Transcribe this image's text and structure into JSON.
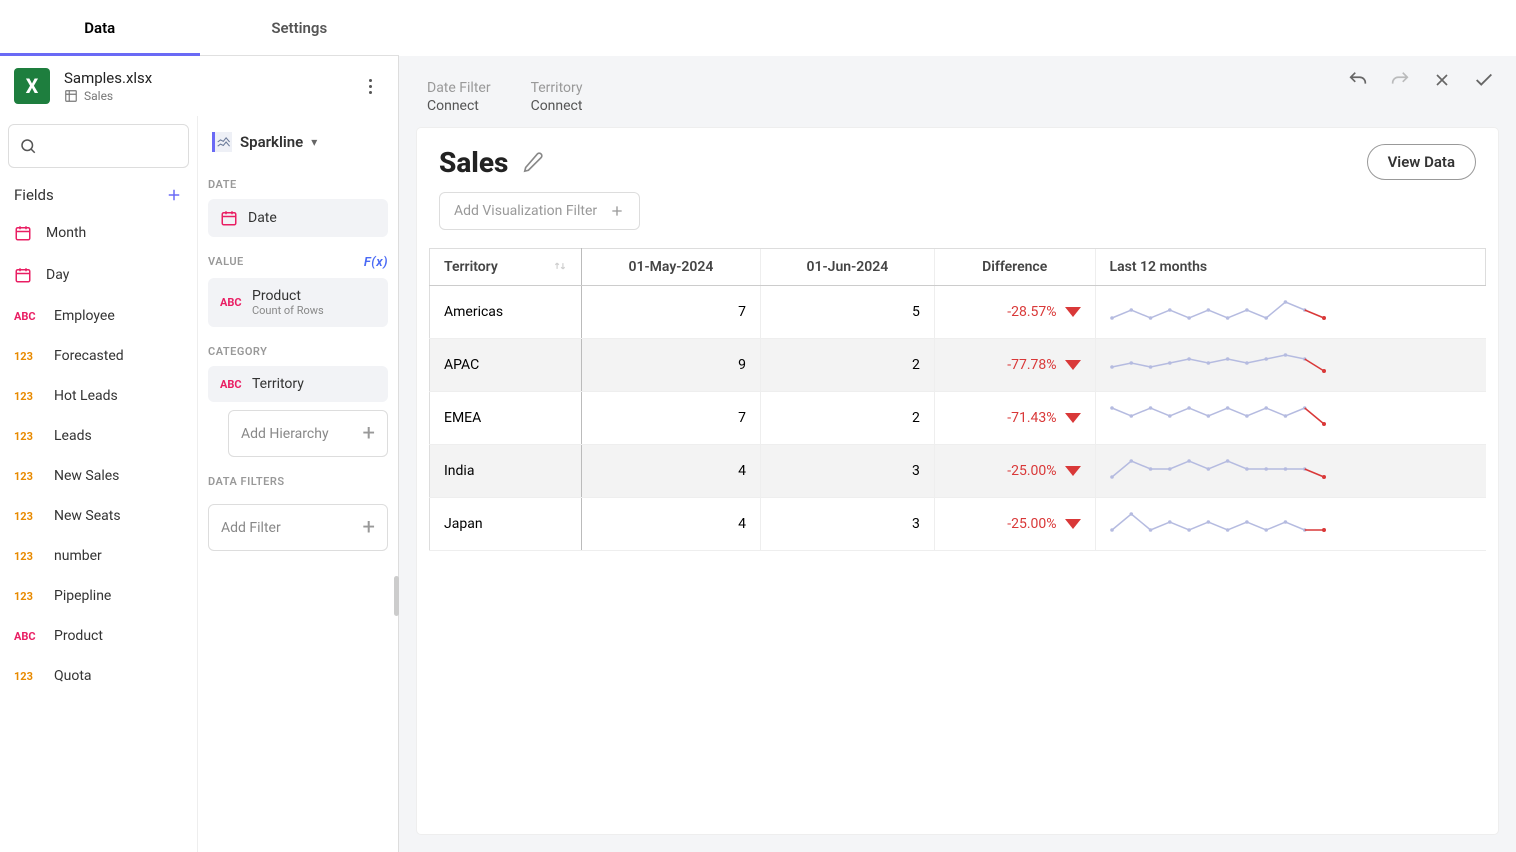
{
  "tabs": {
    "data": "Data",
    "settings": "Settings"
  },
  "dataSource": {
    "file": "Samples.xlsx",
    "sheet": "Sales"
  },
  "search": {
    "placeholder": ""
  },
  "fieldsHeader": "Fields",
  "fields": [
    {
      "type": "date",
      "label": "Month"
    },
    {
      "type": "date",
      "label": "Day"
    },
    {
      "type": "abc",
      "label": "Employee"
    },
    {
      "type": "num",
      "label": "Forecasted"
    },
    {
      "type": "num",
      "label": "Hot Leads"
    },
    {
      "type": "num",
      "label": "Leads"
    },
    {
      "type": "num",
      "label": "New Sales"
    },
    {
      "type": "num",
      "label": "New Seats"
    },
    {
      "type": "num",
      "label": "number"
    },
    {
      "type": "num",
      "label": "Pipepline"
    },
    {
      "type": "abc",
      "label": "Product"
    },
    {
      "type": "num",
      "label": "Quota"
    }
  ],
  "config": {
    "vizLabel": "Sparkline",
    "dateHeading": "DATE",
    "dateField": "Date",
    "valueHeading": "VALUE",
    "fxLabel": "F(x)",
    "valueField": "Product",
    "valueAgg": "Count of Rows",
    "categoryHeading": "CATEGORY",
    "categoryField": "Territory",
    "addHierarchy": "Add Hierarchy",
    "dataFiltersHeading": "DATA FILTERS",
    "addFilter": "Add Filter"
  },
  "topFilters": [
    {
      "label": "Date Filter",
      "value": "Connect"
    },
    {
      "label": "Territory",
      "value": "Connect"
    }
  ],
  "canvas": {
    "title": "Sales",
    "viewData": "View Data",
    "addVizFilter": "Add Visualization Filter",
    "columns": [
      "Territory",
      "01-May-2024",
      "01-Jun-2024",
      "Difference",
      "Last 12 months"
    ]
  },
  "chart_data": {
    "type": "table",
    "rows": [
      {
        "territory": "Americas",
        "may": 7,
        "jun": 5,
        "diff": "-28.57%"
      },
      {
        "territory": "APAC",
        "may": 9,
        "jun": 2,
        "diff": "-77.78%"
      },
      {
        "territory": "EMEA",
        "may": 7,
        "jun": 2,
        "diff": "-71.43%"
      },
      {
        "territory": "India",
        "may": 4,
        "jun": 3,
        "diff": "-25.00%"
      },
      {
        "territory": "Japan",
        "may": 4,
        "jun": 3,
        "diff": "-25.00%"
      }
    ],
    "sparklines": [
      [
        5,
        6,
        5,
        6,
        5,
        6,
        5,
        6,
        5,
        7,
        6,
        5
      ],
      [
        5,
        6,
        5,
        6,
        7,
        6,
        7,
        6,
        7,
        8,
        7,
        4
      ],
      [
        6,
        5,
        6,
        5,
        6,
        5,
        6,
        5,
        6,
        5,
        6,
        4
      ],
      [
        5,
        7,
        6,
        6,
        7,
        6,
        7,
        6,
        6,
        6,
        6,
        5
      ],
      [
        5,
        7,
        5,
        6,
        5,
        6,
        5,
        6,
        5,
        6,
        5,
        5
      ]
    ]
  }
}
